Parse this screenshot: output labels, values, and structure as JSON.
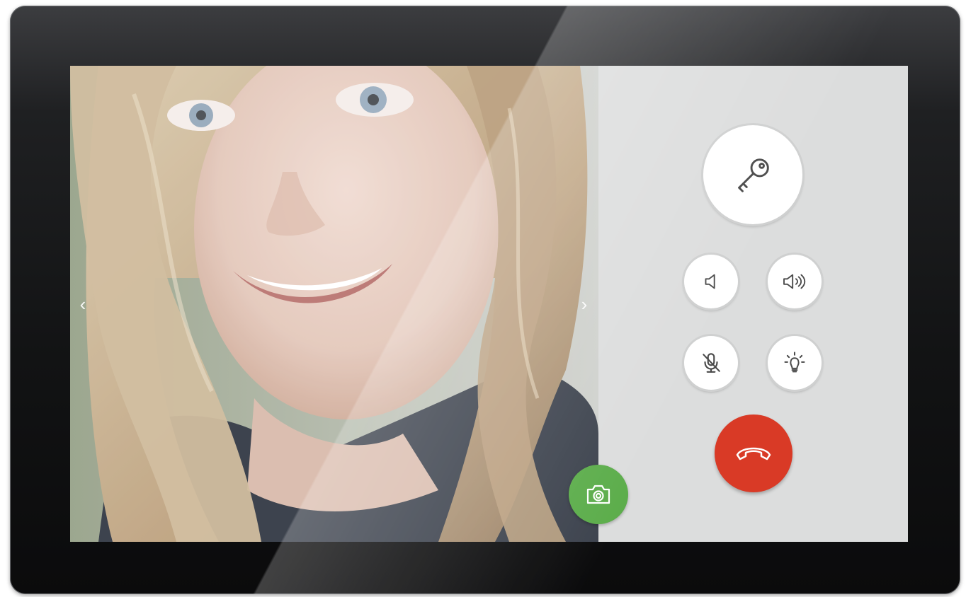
{
  "video": {
    "prev_glyph": "‹",
    "next_glyph": "›"
  },
  "controls": {
    "door_unlock": {
      "icon": "key-icon"
    },
    "volume_down": {
      "icon": "speaker-low-icon"
    },
    "volume_up": {
      "icon": "speaker-high-icon"
    },
    "mute_mic": {
      "icon": "microphone-muted-icon"
    },
    "light": {
      "icon": "lightbulb-icon"
    },
    "hang_up": {
      "icon": "phone-hangup-icon",
      "color": "#d93a26"
    },
    "snapshot": {
      "icon": "camera-icon",
      "color": "#5cad4b"
    }
  }
}
